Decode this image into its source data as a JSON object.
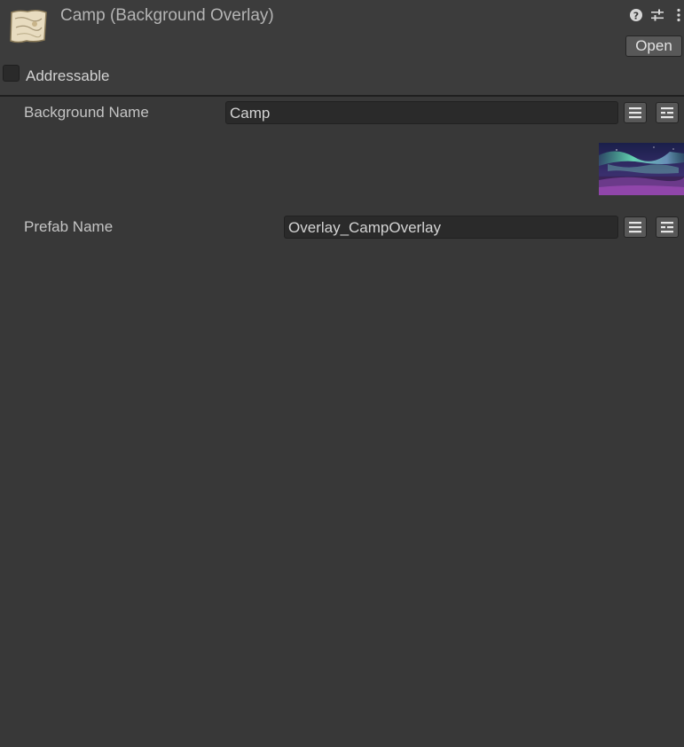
{
  "header": {
    "title": "Camp (Background Overlay)",
    "asset_icon": "scroll-map-icon",
    "help_icon": "help-icon",
    "settings_icon": "settings-sliders-icon",
    "menu_icon": "kebab-menu-icon",
    "open_label": "Open"
  },
  "addressable": {
    "label": "Addressable",
    "checked": false
  },
  "fields": {
    "background_name": {
      "label": "Background Name",
      "value": "Camp",
      "buttons": [
        "list-icon",
        "list-variant-icon"
      ]
    },
    "preview": {
      "icon": "aurora-preview-thumbnail"
    },
    "prefab_name": {
      "label": "Prefab Name",
      "value": "Overlay_CampOverlay",
      "buttons": [
        "list-icon",
        "list-variant-icon"
      ]
    }
  },
  "colors": {
    "panel_bg": "#383838",
    "header_bg": "#3c3c3c",
    "input_bg": "#2a2a2a",
    "button_bg": "#585858",
    "text": "#c4c4c4"
  }
}
